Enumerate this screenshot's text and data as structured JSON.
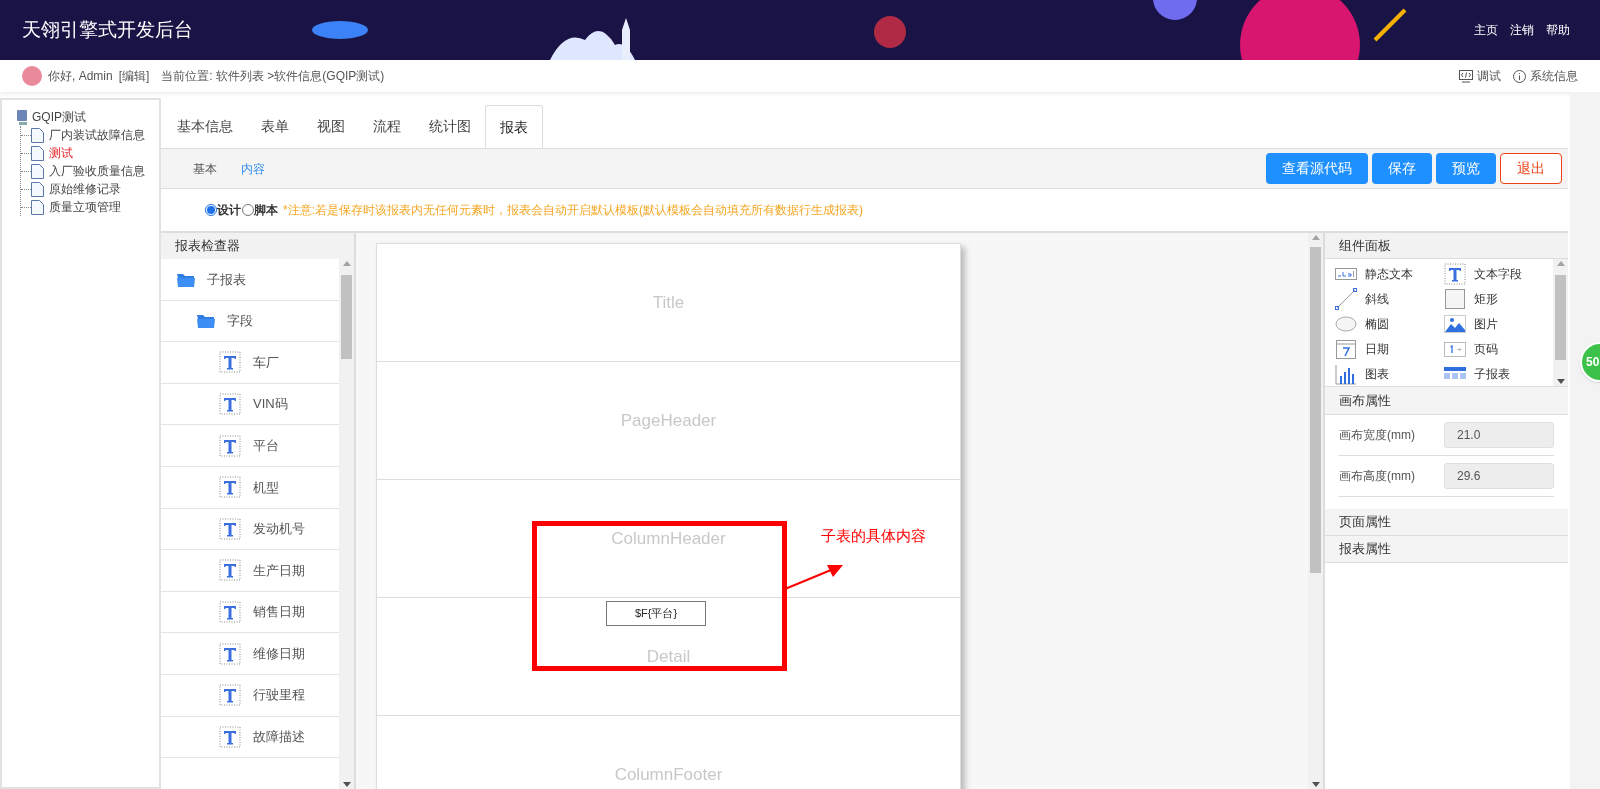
{
  "header": {
    "title": "天翎引擎式开发后台",
    "nav_links": [
      "主页",
      "注销",
      "帮助"
    ]
  },
  "topbar": {
    "greeting": "你好, Admin",
    "edit_link": "[编辑]",
    "breadcrumb": "当前位置: 软件列表 >软件信息(GQIP测试)",
    "actions": [
      {
        "label": "调试",
        "kind": "code"
      },
      {
        "label": "系统信息",
        "kind": "info"
      }
    ]
  },
  "tree": {
    "label": "GQIP测试",
    "children": [
      {
        "label": "厂内装试故障信息",
        "selected": false
      },
      {
        "label": "测试",
        "selected": true
      },
      {
        "label": "入厂验收质量信息",
        "selected": false
      },
      {
        "label": "原始维修记录",
        "selected": false
      },
      {
        "label": "质量立项管理",
        "selected": false
      }
    ]
  },
  "tabs": [
    {
      "label": "基本信息",
      "selected": false
    },
    {
      "label": "表单",
      "selected": false
    },
    {
      "label": "视图",
      "selected": false
    },
    {
      "label": "流程",
      "selected": false
    },
    {
      "label": "统计图",
      "selected": false
    },
    {
      "label": "报表",
      "selected": true
    }
  ],
  "subtabs": [
    {
      "label": "基本",
      "selected": false
    },
    {
      "label": "内容",
      "selected": true
    }
  ],
  "buttons": [
    {
      "label": "查看源代码",
      "kind": "primary"
    },
    {
      "label": "保存",
      "kind": "primary"
    },
    {
      "label": "预览",
      "kind": "primary"
    },
    {
      "label": "退出",
      "kind": "danger"
    }
  ],
  "mode": {
    "options": [
      {
        "label": "设计",
        "selected": true
      },
      {
        "label": "脚本",
        "selected": false
      }
    ],
    "notice": "*注意:若是保存时该报表内无任何元素时，报表会自动开启默认模板(默认模板会自动填充所有数据行生成报表)"
  },
  "inspector": {
    "title": "报表检查器",
    "items": [
      {
        "label": "子报表",
        "kind": "folder",
        "children": [
          {
            "label": "字段",
            "kind": "folder",
            "children": [
              {
                "label": "车厂",
                "kind": "field"
              },
              {
                "label": "VIN码",
                "kind": "field"
              },
              {
                "label": "平台",
                "kind": "field"
              },
              {
                "label": "机型",
                "kind": "field"
              },
              {
                "label": "发动机号",
                "kind": "field"
              },
              {
                "label": "生产日期",
                "kind": "field"
              },
              {
                "label": "销售日期",
                "kind": "field"
              },
              {
                "label": "维修日期",
                "kind": "field"
              },
              {
                "label": "行驶里程",
                "kind": "field"
              },
              {
                "label": "故障描述",
                "kind": "field"
              }
            ]
          }
        ]
      }
    ]
  },
  "canvas": {
    "bands": [
      "Title",
      "PageHeader",
      "ColumnHeader",
      "Detail",
      "ColumnFooter"
    ],
    "field": "$F{平台}",
    "annotation": "子表的具体内容"
  },
  "palette": {
    "title": "组件面板",
    "items": [
      {
        "label": "静态文本",
        "kind": "static_text"
      },
      {
        "label": "文本字段",
        "kind": "text_field"
      },
      {
        "label": "斜线",
        "kind": "line"
      },
      {
        "label": "矩形",
        "kind": "rectangle"
      },
      {
        "label": "椭圆",
        "kind": "ellipse"
      },
      {
        "label": "图片",
        "kind": "image"
      },
      {
        "label": "日期",
        "kind": "date"
      },
      {
        "label": "页码",
        "kind": "page_number"
      },
      {
        "label": "图表",
        "kind": "chart"
      },
      {
        "label": "子报表",
        "kind": "subreport"
      }
    ]
  },
  "canvas_props": {
    "title": "画布属性",
    "fields": [
      {
        "label": "画布宽度(mm)",
        "value": "21.0"
      },
      {
        "label": "画布高度(mm)",
        "value": "29.6"
      }
    ]
  },
  "sections": [
    "页面属性",
    "报表属性"
  ],
  "float_badge": "50"
}
